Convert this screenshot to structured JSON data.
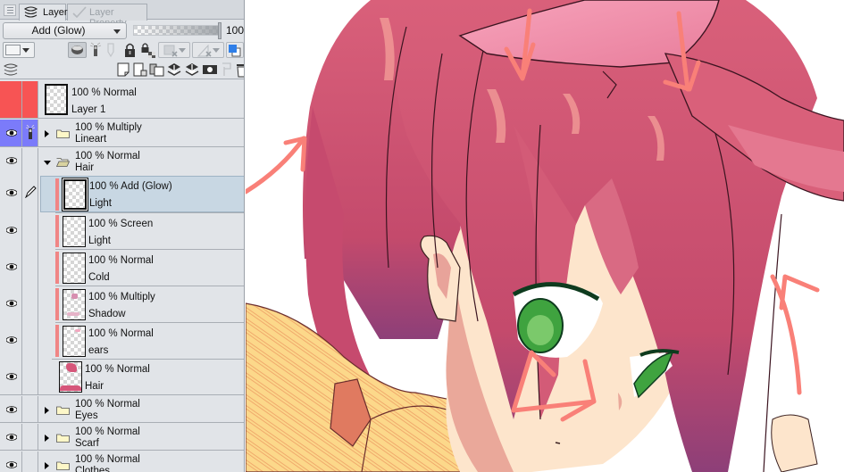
{
  "panel": {
    "tabs": [
      {
        "label": "Layer",
        "icon": "layers-icon",
        "active": true
      },
      {
        "label": "Layer Property",
        "icon": "checkmark-icon",
        "active": false
      }
    ],
    "blend_mode": "Add (Glow)",
    "opacity": 100,
    "opacity_label": "100",
    "toolbar_row1": [
      "color-select-dropdown",
      "clip-to-layer-below-icon",
      "reference-layer-icon",
      "draft-layer-icon",
      "lock-layer-icon",
      "lock-transparent-pixels-icon",
      "mask-dropdown",
      "ruler-dropdown",
      "layer-color-icon"
    ],
    "toolbar_row2": [
      "layer-list-icon",
      "new-raster-layer-icon",
      "new-vector-layer-icon",
      "new-folder-icon",
      "transfer-to-lower-layer-icon",
      "merge-with-lower-layer-icon",
      "create-layer-mask-icon",
      "apply-mask-icon",
      "delete-layer-icon"
    ]
  },
  "layers": [
    {
      "blend": "100 % Normal",
      "name": "Layer 1",
      "type": "raster",
      "selected_red": true,
      "visible": false,
      "depth": 0
    },
    {
      "blend": "100 % Multiply",
      "name": "Lineart",
      "type": "folder",
      "expanded": false,
      "visible": true,
      "reference": true,
      "depth": 0
    },
    {
      "blend": "100 % Normal",
      "name": "Hair",
      "type": "folder",
      "expanded": true,
      "visible": true,
      "depth": 0
    },
    {
      "blend": "100 % Add (Glow)",
      "name": "Light",
      "type": "raster",
      "clipped": true,
      "active": true,
      "visible": true,
      "editing": true,
      "depth": 1
    },
    {
      "blend": "100 % Screen",
      "name": "Light",
      "type": "raster",
      "clipped": true,
      "visible": true,
      "depth": 1
    },
    {
      "blend": "100 % Normal",
      "name": "Cold",
      "type": "raster",
      "clipped": true,
      "visible": true,
      "depth": 1
    },
    {
      "blend": "100 % Multiply",
      "name": "Shadow",
      "type": "raster",
      "clipped": true,
      "visible": true,
      "depth": 1
    },
    {
      "blend": "100 % Normal",
      "name": "ears",
      "type": "raster",
      "clipped": true,
      "visible": true,
      "depth": 1
    },
    {
      "blend": "100 % Normal",
      "name": "Hair",
      "type": "raster",
      "clipped": false,
      "visible": true,
      "depth": 1
    },
    {
      "blend": "100 % Normal",
      "name": "Eyes",
      "type": "folder",
      "expanded": false,
      "visible": true,
      "depth": 0
    },
    {
      "blend": "100 % Normal",
      "name": "Scarf",
      "type": "folder",
      "expanded": false,
      "visible": true,
      "depth": 0
    },
    {
      "blend": "100 % Normal",
      "name": "Clothes",
      "type": "folder",
      "expanded": false,
      "visible": true,
      "depth": 0
    }
  ],
  "colors": {
    "selected_layer_red": "#f75454",
    "reference_blue": "#7b7bfa",
    "clip_bar": "#f08585",
    "active_row": "#c8d7e3",
    "hair": "#d9607a",
    "ear": "#f59ab3",
    "skin": "#fde5cc",
    "eye_green": "#3fa33f",
    "scarf": "#fbd27a",
    "annotation_arrow": "#f98078"
  },
  "canvas": {
    "annotation_arrows": 7,
    "description": "Anime girl with red hair and animal ears; salmon arrows indicate light direction"
  }
}
